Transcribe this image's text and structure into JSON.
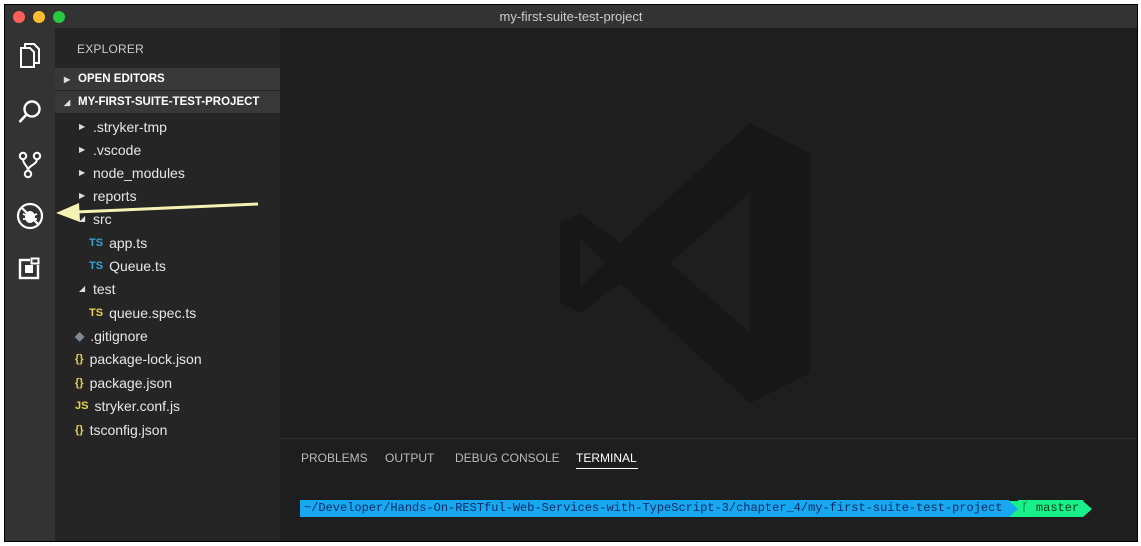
{
  "window": {
    "title": "my-first-suite-test-project"
  },
  "activity_bar": {
    "items": [
      "explorer-icon",
      "search-icon",
      "source-control-icon",
      "debug-icon",
      "extensions-icon"
    ]
  },
  "sidebar": {
    "title": "EXPLORER",
    "open_editors": "OPEN EDITORS",
    "project": "MY-FIRST-SUITE-TEST-PROJECT",
    "tree": [
      {
        "label": ".stryker-tmp",
        "kind": "folder",
        "expanded": false
      },
      {
        "label": ".vscode",
        "kind": "folder",
        "expanded": false
      },
      {
        "label": "node_modules",
        "kind": "folder",
        "expanded": false
      },
      {
        "label": "reports",
        "kind": "folder",
        "expanded": false
      },
      {
        "label": "src",
        "kind": "folder",
        "expanded": true
      },
      {
        "label": "app.ts",
        "kind": "ts",
        "badge": "TS"
      },
      {
        "label": "Queue.ts",
        "kind": "ts",
        "badge": "TS"
      },
      {
        "label": "test",
        "kind": "folder",
        "expanded": true
      },
      {
        "label": "queue.spec.ts",
        "kind": "ts-spec",
        "badge": "TS"
      },
      {
        "label": ".gitignore",
        "kind": "git",
        "badge": "◆"
      },
      {
        "label": "package-lock.json",
        "kind": "json",
        "badge": "{}"
      },
      {
        "label": "package.json",
        "kind": "json",
        "badge": "{}"
      },
      {
        "label": "stryker.conf.js",
        "kind": "js",
        "badge": "JS"
      },
      {
        "label": "tsconfig.json",
        "kind": "json",
        "badge": "{}"
      }
    ]
  },
  "panel": {
    "tabs": [
      "PROBLEMS",
      "OUTPUT",
      "DEBUG CONSOLE",
      "TERMINAL"
    ],
    "active_tab": "TERMINAL",
    "terminal": {
      "path": "~/Developer/Hands-On-RESTful-Web-Services-with-TypeScript-3/chapter_4/my-first-suite-test-project",
      "branch": "master"
    }
  },
  "colors": {
    "ts_badge": "#2fa6d9",
    "ts_spec_badge": "#e8d44d",
    "json_badge": "#e8d44d",
    "js_badge": "#e8d44d",
    "path_bg": "#18a8f0",
    "branch_bg": "#18f08a",
    "annotation_arrow": "#f6f2b4"
  }
}
